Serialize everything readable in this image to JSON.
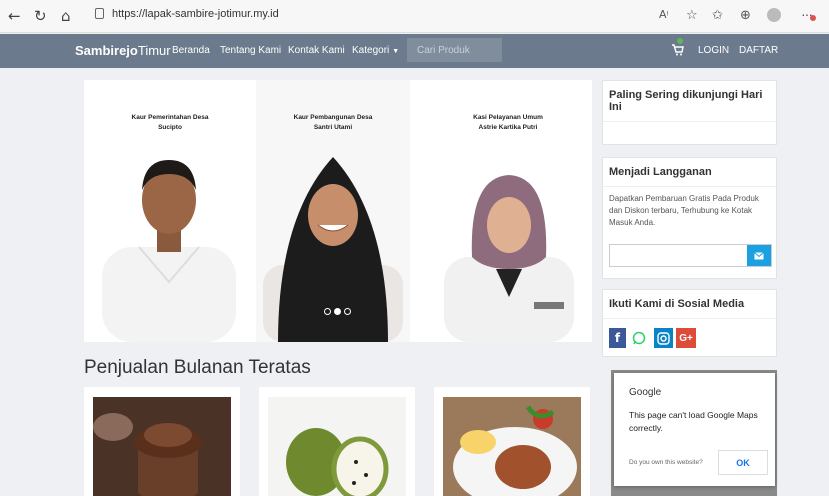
{
  "browser": {
    "url": "https://lapak-sambire-jotimur.my.id"
  },
  "navbar": {
    "brand_bold": "Sambirejo",
    "brand_rest": "Timur",
    "links": [
      "Beranda",
      "Tentang Kami",
      "Kontak Kami",
      "Kategori"
    ],
    "search_placeholder": "Cari Produk",
    "login": "LOGIN",
    "register": "DAFTAR"
  },
  "carousel": {
    "slides": [
      {
        "role": "Kaur Pemerintahan Desa",
        "name": "Sucipto"
      },
      {
        "role": "Kaur Pembangunan Desa",
        "name": "Santri Utami"
      },
      {
        "role": "Kasi Pelayanan Umum",
        "name": "Astrie Kartika Putri"
      }
    ],
    "active_index": 1,
    "dot_count": 3
  },
  "main": {
    "section_title": "Penjualan Bulanan Teratas"
  },
  "sidebar": {
    "popular_title": "Paling Sering dikunjungi Hari Ini",
    "subscribe_title": "Menjadi Langganan",
    "subscribe_text": "Dapatkan Pembaruan Gratis Pada Produk dan Diskon terbaru, Terhubung ke Kotak Masuk Anda.",
    "social_title": "Ikuti Kami di Sosial Media",
    "social_icons": [
      "facebook-icon",
      "whatsapp-icon",
      "instagram-icon",
      "google-plus-icon"
    ]
  },
  "map_error": {
    "title": "Google",
    "message": "This page can't load Google Maps correctly.",
    "question": "Do you own this website?",
    "ok": "OK"
  },
  "colors": {
    "navbar": "#6b7a8c",
    "accent": "#1ba1e2",
    "facebook": "#3b5998",
    "whatsapp": "#25d366",
    "instagram": "#0a84c6",
    "google_plus": "#dd4b39"
  }
}
